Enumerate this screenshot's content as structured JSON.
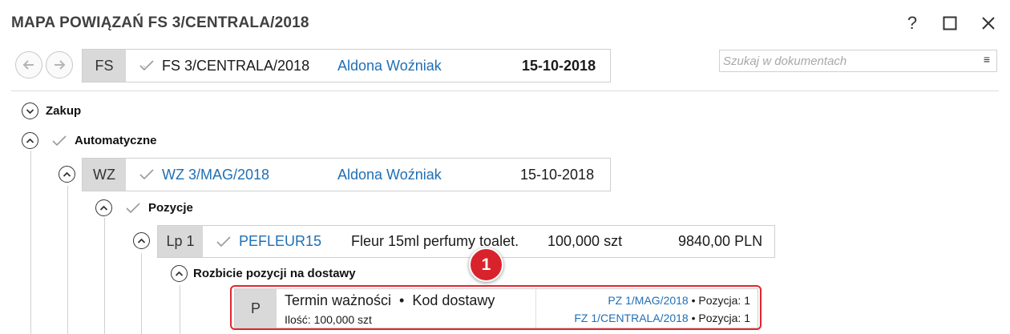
{
  "window": {
    "title": "MAPA POWIĄZAŃ FS 3/CENTRALA/2018",
    "help_label": "?"
  },
  "main_doc": {
    "type": "FS",
    "number": "FS 3/CENTRALA/2018",
    "user": "Aldona Woźniak",
    "date": "15-10-2018"
  },
  "search": {
    "placeholder": "Szukaj w dokumentach",
    "value": "",
    "menu_glyph": "≡"
  },
  "tree": {
    "zakup": {
      "label": "Zakup"
    },
    "automatyczne": {
      "label": "Automatyczne"
    },
    "wz_doc": {
      "type": "WZ",
      "number": "WZ 3/MAG/2018",
      "user": "Aldona Woźniak",
      "date": "15-10-2018"
    },
    "pozycje": {
      "label": "Pozycje"
    },
    "position": {
      "type": "Lp 1",
      "code": "PEFLEUR15",
      "name": "Fleur 15ml perfumy toalet.",
      "quantity": "100,000 szt",
      "price": "9840,00 PLN"
    },
    "rozbicie": {
      "label": "Rozbicie pozycji na dostawy"
    },
    "delivery": {
      "type": "P",
      "title": "Termin ważności  •  Kod dostawy",
      "quantity": "Ilość: 100,000 szt",
      "ref1_doc": "PZ 1/MAG/2018",
      "ref1_suffix": " • Pozycja: 1",
      "ref2_doc": "FZ 1/CENTRALA/2018",
      "ref2_suffix": " • Pozycja: 1"
    }
  },
  "annotation": {
    "badge_number": "1",
    "color": "#d9232c"
  },
  "colors": {
    "link": "#1f6fb5",
    "type_cell": "#d9d9d9",
    "highlight": "#e0262f"
  }
}
